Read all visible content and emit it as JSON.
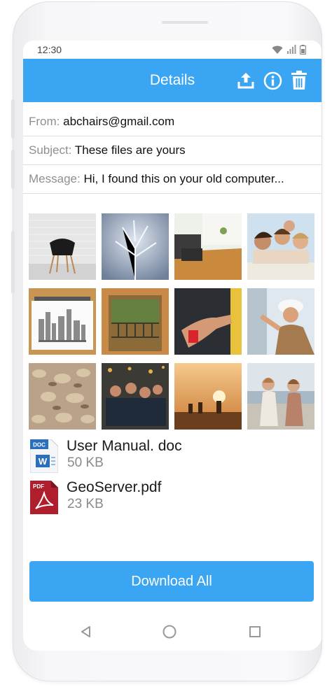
{
  "status": {
    "time": "12:30"
  },
  "appbar": {
    "title": "Details",
    "actions": [
      "upload-icon",
      "info-icon",
      "trash-icon"
    ]
  },
  "details": {
    "from_label": "From:",
    "from_value": "abchairs@gmail.com",
    "subject_label": "Subject:",
    "subject_value": "These files are yours",
    "message_label": "Message:",
    "message_value": "Hi, I found this on your old computer..."
  },
  "photos": [
    {
      "subject": "black chair by white brick wall"
    },
    {
      "subject": "frosted plant"
    },
    {
      "subject": "living room interior"
    },
    {
      "subject": "group of smiling friends"
    },
    {
      "subject": "sketchbook city drawing"
    },
    {
      "subject": "old building balcony"
    },
    {
      "subject": "hands with tape measure"
    },
    {
      "subject": "worker in hard hat"
    },
    {
      "subject": "dry leaves"
    },
    {
      "subject": "people at night party"
    },
    {
      "subject": "sunset silhouettes"
    },
    {
      "subject": "two women walking"
    }
  ],
  "attachments": [
    {
      "name": "User Manual. doc",
      "size": "50 KB",
      "icon": "word-doc-icon",
      "badge": "DOC"
    },
    {
      "name": "GeoServer.pdf",
      "size": "23 KB",
      "icon": "pdf-icon",
      "badge": "PDF"
    }
  ],
  "download_label": "Download All",
  "colors": {
    "accent": "#3aa6f3",
    "pdf": "#b01e2d",
    "doc": "#2a6ebd"
  }
}
